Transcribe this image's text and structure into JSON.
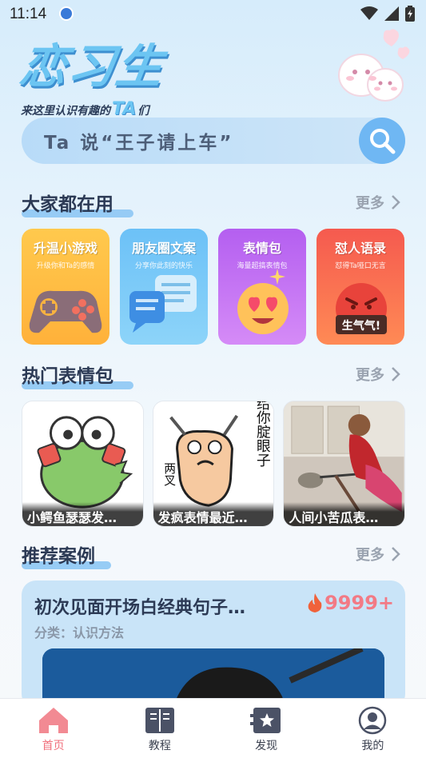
{
  "status_bar": {
    "time": "11:14"
  },
  "brand": {
    "title": "恋习生",
    "slogan_prefix": "来这里认识有趣的",
    "slogan_ta": "TA",
    "slogan_suffix": "们"
  },
  "search": {
    "placeholder": "Ta 说“王子请上车”"
  },
  "sections": {
    "popular": {
      "title": "大家都在用",
      "more": "更多"
    },
    "hot_emoji": {
      "title": "热门表情包",
      "more": "更多"
    },
    "recommend": {
      "title": "推荐案例",
      "more": "更多"
    }
  },
  "tools": [
    {
      "title": "升温小游戏",
      "subtitle": "升级你和Ta的感情",
      "color_top": "#ffc94d",
      "color_bottom": "#ffb13a"
    },
    {
      "title": "朋友圈文案",
      "subtitle": "分享你此刻的快乐",
      "color_top": "#6cc1f7",
      "color_bottom": "#8dd4f9"
    },
    {
      "title": "表情包",
      "subtitle": "海量超搞表情包",
      "color_top": "#b45ff0",
      "color_bottom": "#d58bf7"
    },
    {
      "title": "怼人语录",
      "subtitle": "怼得Ta哑口无言",
      "color_top": "#f55a4f",
      "color_bottom": "#ff8a55"
    }
  ],
  "tool_art_text": {
    "angry_sign": "生气气!"
  },
  "emojis": [
    {
      "caption": "小鳄鱼瑟瑟发…"
    },
    {
      "caption": "发疯表情最近…",
      "text_side": "给你腚眼子",
      "text_bottom": "两叉"
    },
    {
      "caption": "人间小苦瓜表…"
    }
  ],
  "case": {
    "title": "初次见面开场白经典句子…",
    "hot_count": "9999+",
    "category": "分类：认识方法"
  },
  "tabs": [
    {
      "label": "首页",
      "icon": "home-icon",
      "active": true
    },
    {
      "label": "教程",
      "icon": "book-icon",
      "active": false
    },
    {
      "label": "发现",
      "icon": "discover-icon",
      "active": false
    },
    {
      "label": "我的",
      "icon": "profile-icon",
      "active": false
    }
  ],
  "colors": {
    "accent_blue": "#6cc5f2",
    "accent_pink": "#f0707c",
    "hot_red": "#f27a85"
  }
}
